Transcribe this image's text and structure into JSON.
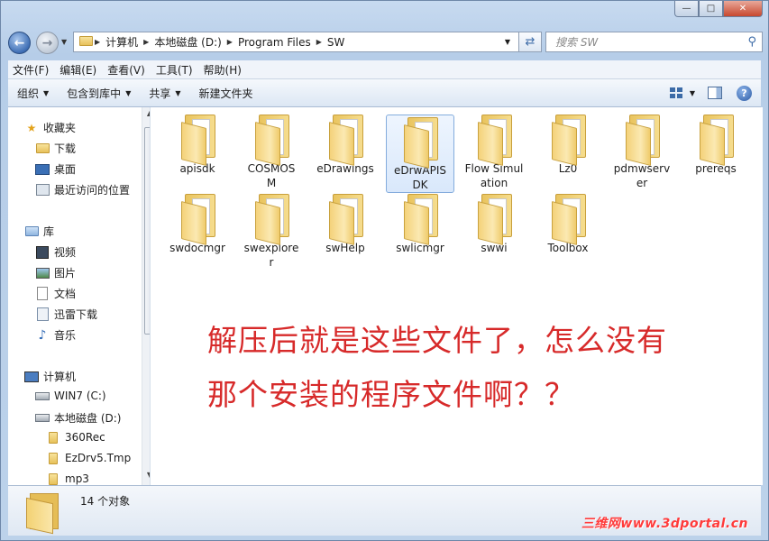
{
  "window": {
    "minimize": "—",
    "maximize": "□",
    "close": "✕"
  },
  "nav": {
    "breadcrumbs": [
      "计算机",
      "本地磁盘 (D:)",
      "Program Files",
      "SW"
    ],
    "search_placeholder": "搜索 SW"
  },
  "menu": [
    "文件(F)",
    "编辑(E)",
    "查看(V)",
    "工具(T)",
    "帮助(H)"
  ],
  "commands": {
    "organize": "组织",
    "include_library": "包含到库中",
    "share": "共享",
    "new_folder": "新建文件夹"
  },
  "sidebar": {
    "favorites": "收藏夹",
    "fav_items": [
      "下载",
      "桌面",
      "最近访问的位置"
    ],
    "libraries": "库",
    "lib_items": [
      "视频",
      "图片",
      "文档",
      "迅雷下载",
      "音乐"
    ],
    "computer": "计算机",
    "drives": [
      "WIN7 (C:)",
      "本地磁盘 (D:)"
    ],
    "folders": [
      "360Rec",
      "EzDrv5.Tmp",
      "mp3"
    ]
  },
  "files": [
    "apisdk",
    "COSMOSM",
    "eDrawings",
    "eDrwAPISDK",
    "Flow Simulation",
    "Lz0",
    "pdmwserver",
    "prereqs",
    "swdocmgr",
    "swexplorer",
    "swHelp",
    "swlicmgr",
    "swwi",
    "Toolbox"
  ],
  "annotation": {
    "line1": "解压后就是这些文件了，怎么没有",
    "line2": "那个安装的程序文件啊？？"
  },
  "status": {
    "count": "14 个对象"
  },
  "watermark": "三维网www.3dportal.cn",
  "colors": {
    "annotation": "#d72a2a",
    "accent": "#3c6ba7"
  }
}
